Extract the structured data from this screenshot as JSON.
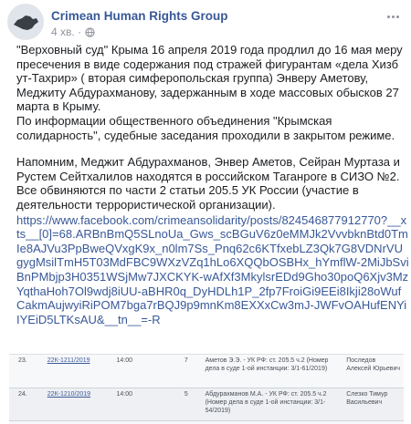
{
  "author": {
    "name": "Crimean Human Rights Group"
  },
  "meta": {
    "time": "4 хв. ·"
  },
  "icons": {
    "avatar": "crimea-map-avatar",
    "visibility": "globe-icon",
    "menu": "more-options-icon"
  },
  "post": {
    "paragraph1": "\"Верховный суд\" Крыма 16 апреля 2019 года продлил до 16 мая меру пресечения в виде содержания под стражей фигурантам «дела Хизб ут-Тахрир» ( вторая симферопольская группа) Энверу Аметову, Меджиту Абдурахманову, задержанным в ходе массовых обысков 27 марта в Крыму.",
    "paragraph2": "По информации общественного объединения \"Крымская солидарность\", судебные заседания проходили в закрытом режиме.",
    "paragraph3": "Напомним, Меджит Абдурахманов, Энвер Аметов, Сейран Муртаза и Рустем Сейтхалилов находятся в российском Таганроге в СИЗО №2. Все обвиняются по части 2 статьи 205.5 УК России (участие в деятельности террористической организации).",
    "link": "https://www.facebook.com/crimeansolidarity/posts/824546877912770?__xts__[0]=68.ARBnBmQ5SLnoUa_Gws_scBGuV6z0eMMJk2VvvbknBtd0TmIe8AJVu3PpBweQVxgK9x_n0lm7Ss_Pnq62c6KTfxebLZ3Qk7G8VDNrVUgygMsilTmH5T03MdFBC9WXzVZq1hLo6XQQbOSBHx_hYmflW-2MiJbSviBnPMbjp3H0351WSjMw7JXCKYK-wAfXf3MkylsrEDd9Gho30poQ6Xjv3MzYqthaHoh7Ol9wdj8iUU-aBHR0q_DyHDLh1P_2fp7FroiGi9EEi8Ikji28oWufCakmAujwyiRiPOM7bga7rBQJ9p9mnKm8EXXxCw3mJ-JWFvOAHufENYiIYEiD5LTKsAU&__tn__=-R"
  },
  "court_table": {
    "rows": [
      {
        "num": "23.",
        "case": "22К-1211/2019",
        "time": "14:00",
        "hall": "7",
        "desc": "Аметов Э.Э. - УК РФ: ст. 205.5 ч.2 (Номер дела в суде 1-ой инстанции: 3/1-61/2019)",
        "judge": "Послед­ов Алексей Юрьевич"
      },
      {
        "num": "24.",
        "case": "22К-1210/2019",
        "time": "14:00",
        "hall": "5",
        "desc": "Абдурахманов М.А. - УК РФ: ст. 205.5 ч.2 (Номер дела в суде 1-ой инстанции: 3/1-54/2019)",
        "judge": "Слезко Тимур Васильевич"
      }
    ]
  }
}
